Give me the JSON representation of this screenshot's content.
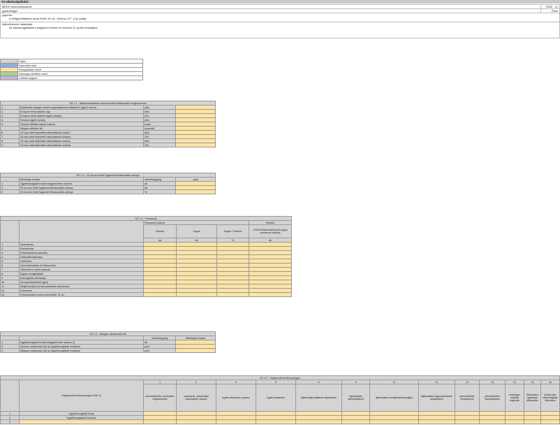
{
  "page_title": "Az adatszolgáltatás",
  "header": {
    "row1_label": "MEKH azonosítószáma:",
    "row1_value": "SZ62 - v1",
    "row2_label": "gyakorisága:",
    "row2_value": "Éves",
    "row3_label": "jogcíme:",
    "row3_value": "A földgázellátásról szóló 2008. évi XL. törvény 127. § a) pontja",
    "row4_label": "teljesítésének határideje:",
    "row4_value": "Az adatszolgáltatást a tárgyévet követő év március 31-ig kell benyújtani."
  },
  "legend": {
    "items": [
      {
        "label": "Fejléc",
        "color": "#d4d4d4"
      },
      {
        "label": "Számított cella",
        "color": "#8eaee0"
      },
      {
        "label": "Szolgáltatási mező",
        "color": "#fce4a6"
      },
      {
        "label": "Szöveges kitöltési mező",
        "color": "#a9d18e"
      },
      {
        "label": "Letiltott négyzet",
        "color": "#c6b3d6"
      }
    ]
  },
  "t1": {
    "title": "SZ 1.1 - Adatmódosítások dokumentált felhasználói megkeresése",
    "rows": [
      {
        "n": "1",
        "label": "Bejelentés alapján másik engedélyeshez átadandó ügyek száma",
        "unit": "(db)"
      },
      {
        "n": "2",
        "label": "8 napon belül átadott ügy",
        "unit": "(db)"
      },
      {
        "n": "3",
        "label": "8 napon belül átadott ügyek aránya",
        "unit": "(%)"
      },
      {
        "n": "4",
        "label": "Összes ügyek száma",
        "unit": "(db)"
      },
      {
        "n": "5",
        "label": "Összes átfutási napok száma",
        "unit": "(nap)"
      },
      {
        "n": "",
        "label": "Átlagos átfutási idő",
        "unit": "(nap/db)"
      },
      {
        "n": "6",
        "label": "15 nap alatt teljesített változtatások száma",
        "unit": "(db)"
      },
      {
        "n": "7",
        "label": "15 nap alatt teljesített változtatások aránya",
        "unit": "(%)"
      },
      {
        "n": "8",
        "label": "15 nap alatt teljesített változtatások száma",
        "unit": "(db)"
      },
      {
        "n": "9",
        "label": "15 nap alatt teljesített változtatások aránya",
        "unit": "(%)"
      }
    ]
  },
  "t2": {
    "title": "SZ 1.4 - 20 percen belül fogadott felhasználók aránya",
    "head": [
      "Minőségi mutató",
      "mértékegység",
      "adat"
    ],
    "rows": [
      {
        "n": "1",
        "label": "Ügyfélszolgálati irodai megjelenések száma",
        "unit": "db"
      },
      {
        "n": "2",
        "label": "20 percen belül fogadott felhasználók száma",
        "unit": "db"
      },
      {
        "n": "3",
        "label": "20 percen belül fogadott felhasználók aránya",
        "unit": "%"
      }
    ]
  },
  "t3": {
    "title": "SZ 2.1 - Panaszok",
    "group1": "Panaszok száma",
    "group2": "Mutató",
    "cols": [
      "Összes",
      "Jogos",
      "Jogos / Összes",
      "1000 felhasználóra jutó jogos panaszok aránya"
    ],
    "units": [
      "db",
      "db",
      "%",
      "db"
    ],
    "rows": [
      {
        "n": "1",
        "label": "Számlázás"
      },
      {
        "n": "2",
        "label": "Elszámolás"
      },
      {
        "n": "3",
        "label": "Fizetési/mérés-kezelés"
      },
      {
        "n": "4",
        "label": "Hálózatleválasztás"
      },
      {
        "n": "5",
        "label": "Kártérítés"
      },
      {
        "n": "6",
        "label": "Szerződéskötés és felmondás"
      },
      {
        "n": "7",
        "label": "Hálózati és mérő tartozás"
      },
      {
        "n": "8",
        "label": "Egyéb szolgáltatási"
      },
      {
        "n": "9",
        "label": "Kiszolgálás minősége"
      },
      {
        "n": "10",
        "label": "Környezetvédelmi igény"
      },
      {
        "n": "11",
        "label": "Megtévesztés és kereskedelmi ellenőrzés"
      },
      {
        "n": "12",
        "label": "Összesen"
      },
      {
        "n": "13",
        "label": "Felhasználók száma december 31-én"
      }
    ]
  },
  "t4": {
    "title": "SZ 2.2 - Átlagos várakozási idő",
    "head": [
      "mértékegység",
      "Minőségi mutató"
    ],
    "rows": [
      {
        "n": "1",
        "label": "Ügyfélszolgálati irodai megjelenések száma 1)",
        "unit": "db"
      },
      {
        "n": "2",
        "label": "Összes várakozási idő az ügyfélszolgálati irodában",
        "unit": "perc"
      },
      {
        "n": "3",
        "label": "Átlagos várakozási idő az ügyfélszolgálati irodában",
        "unit": "perc"
      }
    ]
  },
  "t5": {
    "title": "SZ 2.3 - Végzendő tevékenységek",
    "rowhead": "Végzendő tevékenységek köre 2)",
    "nums": [
      "1",
      "2",
      "3",
      "6",
      "8",
      "9",
      "10",
      "11",
      "12",
      "13",
      "14",
      "15",
      "16"
    ],
    "cols": [
      "szerződéskötés, módosítás, megszüntetés",
      "számlázás, elszámolási reklamációk, panasz",
      "egyéb reklamáció, panasz",
      "egyéb bejelentés",
      "tájékoztatás általános eljárásokról",
      "tájékoztatás árakról/díjakról",
      "tájékoztatás energiahatékonyságról",
      "tájékoztatás fogyasztóvédelmi szabályokról",
      "pénzbefizetés készpénzzel",
      "pénzbefizetés bankkártyával",
      "lehetséges átutalási megbízás",
      "Elektronikus ügyfélkapu alkalmazás",
      "Elektronikus időpontfoglalás biztosítása"
    ],
    "rows": [
      {
        "n": "1",
        "label": "Ügyfélszolgálati iroda"
      },
      {
        "n": "2",
        "label": "Ügyfélszolgálati fiókiroda"
      },
      {
        "n": "3",
        "label": ""
      }
    ]
  }
}
